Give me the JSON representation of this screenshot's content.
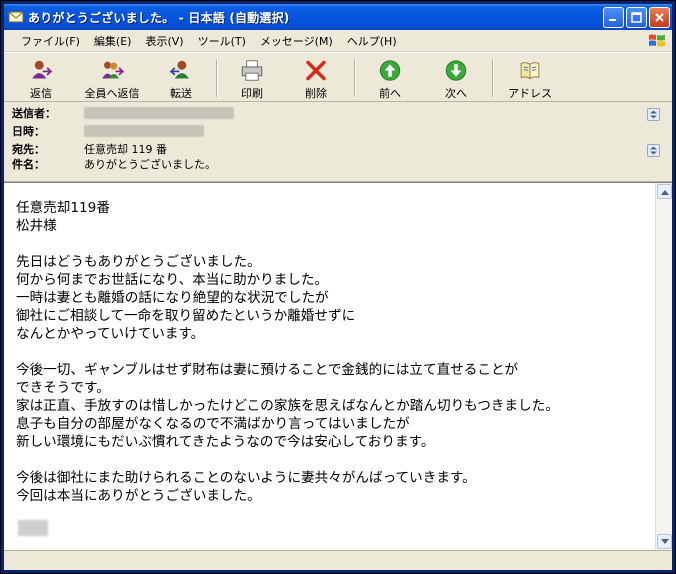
{
  "window": {
    "title": "ありがとうございました。 - 日本語 (自動選択)"
  },
  "menu": {
    "items": [
      "ファイル(F)",
      "編集(E)",
      "表示(V)",
      "ツール(T)",
      "メッセージ(M)",
      "ヘルプ(H)"
    ]
  },
  "toolbar": {
    "reply": "返信",
    "reply_all": "全員へ返信",
    "forward": "転送",
    "print": "印刷",
    "delete": "削除",
    "previous": "前へ",
    "next": "次へ",
    "addresses": "アドレス"
  },
  "headers": {
    "from_label": "送信者：",
    "date_label": "日時：",
    "to_label": "宛先：",
    "to_value": "任意売却 119 番",
    "subject_label": "件名：",
    "subject_value": "ありがとうございました。"
  },
  "message": {
    "body": "任意売却119番\n松井様\n\n先日はどうもありがとうございました。\n何から何までお世話になり、本当に助かりました。\n一時は妻とも離婚の話になり絶望的な状況でしたが\n御社にご相談して一命を取り留めたというか離婚せずに\nなんとかやっていけています。\n\n今後一切、ギャンブルはせず財布は妻に預けることで金銭的には立て直せることが\nできそうです。\n家は正直、手放すのは惜しかったけどこの家族を思えばなんとか踏ん切りもつきました。\n息子も自分の部屋がなくなるので不満ばかり言ってはいましたが\n新しい環境にもだいぶ慣れてきたようなので今は安心しております。\n\n今後は御社にまた助けられることのないように妻共々がんばっていきます。\n今回は本当にありがとうございました。"
  },
  "colors": {
    "titlebar": "#0554e0",
    "chrome": "#ece9d8",
    "body_bg": "#ffffff"
  }
}
